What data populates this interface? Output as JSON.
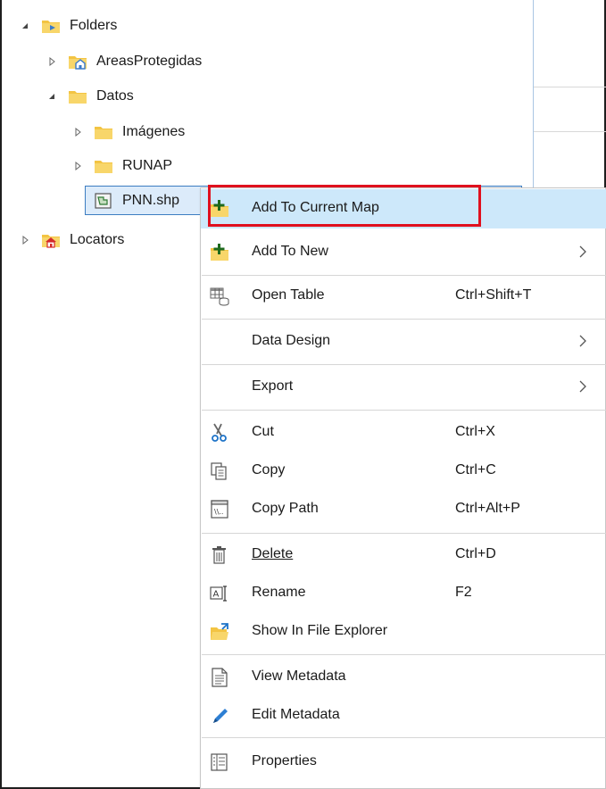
{
  "tree": {
    "folders": "Folders",
    "areas_protegidas": "AreasProtegidas",
    "datos": "Datos",
    "imagenes": "Imágenes",
    "runap": "RUNAP",
    "pnn": "PNN.shp",
    "locators": "Locators"
  },
  "menu": {
    "add_to_current_map": "Add To Current Map",
    "add_to_new": "Add To New",
    "open_table": "Open Table",
    "open_table_shortcut": "Ctrl+Shift+T",
    "data_design": "Data Design",
    "export": "Export",
    "cut": "Cut",
    "cut_shortcut": "Ctrl+X",
    "copy": "Copy",
    "copy_shortcut": "Ctrl+C",
    "copy_path": "Copy Path",
    "copy_path_shortcut": "Ctrl+Alt+P",
    "delete": "Delete",
    "delete_shortcut": "Ctrl+D",
    "rename": "Rename",
    "rename_shortcut": "F2",
    "show_in_explorer": "Show In File Explorer",
    "view_metadata": "View Metadata",
    "edit_metadata": "Edit Metadata",
    "properties": "Properties"
  },
  "colors": {
    "folder": "#f3c443",
    "highlight": "#cde8fa",
    "annotation": "#e0101e"
  }
}
